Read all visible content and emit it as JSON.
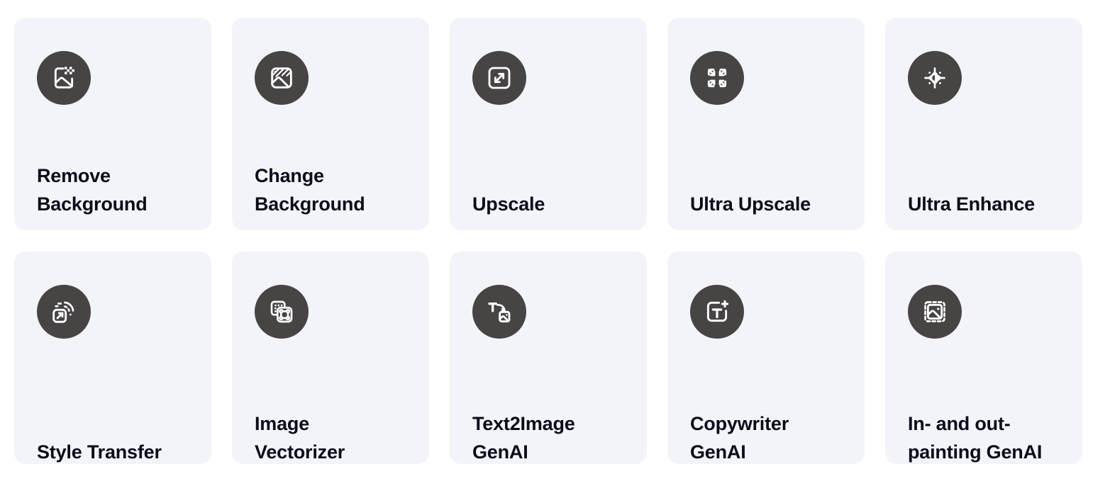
{
  "grid": {
    "columns": 5,
    "rows": 2,
    "card_bg": "#f3f4f9",
    "icon_bg": "#474444",
    "icon_fg": "#ffffff",
    "label_color": "#0b0b1a"
  },
  "cards": [
    {
      "id": "remove-background",
      "label": "Remove Background",
      "lines": [
        "Remove",
        "Background"
      ],
      "icon": "image-checkerboard-icon",
      "row": 1
    },
    {
      "id": "change-background",
      "label": "Change Background",
      "lines": [
        "Change",
        "Background"
      ],
      "icon": "image-hatched-icon",
      "row": 1
    },
    {
      "id": "upscale",
      "label": "Upscale",
      "lines": [
        "Upscale"
      ],
      "icon": "expand-diagonal-arrows-icon",
      "row": 1
    },
    {
      "id": "ultra-upscale",
      "label": "Ultra Upscale",
      "lines": [
        "Ultra Upscale"
      ],
      "icon": "four-corner-arrows-icon",
      "row": 1
    },
    {
      "id": "ultra-enhance",
      "label": "Ultra Enhance",
      "lines": [
        "Ultra Enhance"
      ],
      "icon": "contrast-radiate-icon",
      "row": 1
    },
    {
      "id": "style-transfer",
      "label": "Style Transfer",
      "lines": [
        "Style Transfer"
      ],
      "icon": "share-square-waves-icon",
      "row": 2
    },
    {
      "id": "image-vectorizer",
      "label": "Image Vectorizer",
      "lines": [
        "Image",
        "Vectorizer"
      ],
      "icon": "pixels-to-vector-icon",
      "row": 2
    },
    {
      "id": "text2image-genai",
      "label": "Text2Image GenAI",
      "lines": [
        "Text2Image",
        "GenAI"
      ],
      "icon": "text-arrow-image-icon",
      "row": 2
    },
    {
      "id": "copywriter-genai",
      "label": "Copywriter GenAI",
      "lines": [
        "Copywriter",
        "GenAI"
      ],
      "icon": "text-square-plus-icon",
      "row": 2
    },
    {
      "id": "in-and-out-painting-genai",
      "label": "In- and out-painting GenAI",
      "lines": [
        "In- and out-",
        "painting GenAI"
      ],
      "icon": "image-dashed-border-icon",
      "row": 2
    }
  ]
}
